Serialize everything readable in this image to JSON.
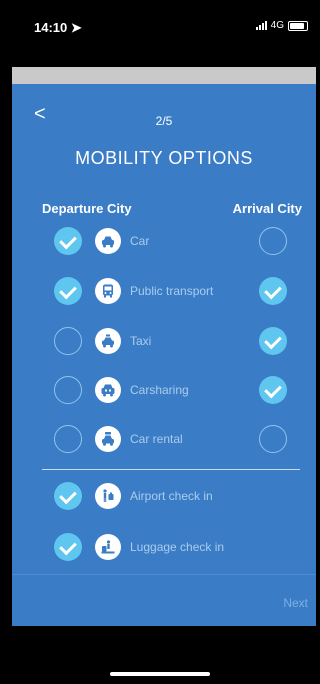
{
  "status": {
    "time": "14:10 ➤",
    "network": "4G"
  },
  "nav": {
    "back": "<",
    "step": "2/5"
  },
  "title": "MOBILITY OPTIONS",
  "columns": {
    "departure": "Departure City",
    "arrival": "Arrival City"
  },
  "options": [
    {
      "label": "Car",
      "icon": "car-icon",
      "departure": true,
      "arrival": false
    },
    {
      "label": "Public transport",
      "icon": "bus-icon",
      "departure": true,
      "arrival": true
    },
    {
      "label": "Taxi",
      "icon": "taxi-icon",
      "departure": false,
      "arrival": true
    },
    {
      "label": "Carsharing",
      "icon": "carsharing-icon",
      "departure": false,
      "arrival": true
    },
    {
      "label": "Car rental",
      "icon": "car-rental-icon",
      "departure": false,
      "arrival": false
    }
  ],
  "services": [
    {
      "label": "Airport check in",
      "icon": "airport-checkin-icon",
      "checked": true
    },
    {
      "label": "Luggage check in",
      "icon": "luggage-checkin-icon",
      "checked": true
    }
  ],
  "footer": {
    "next": "Next"
  },
  "colors": {
    "screen": "#3a7cc5",
    "check_on": "#5ec6ef",
    "label": "#a9cdee"
  }
}
